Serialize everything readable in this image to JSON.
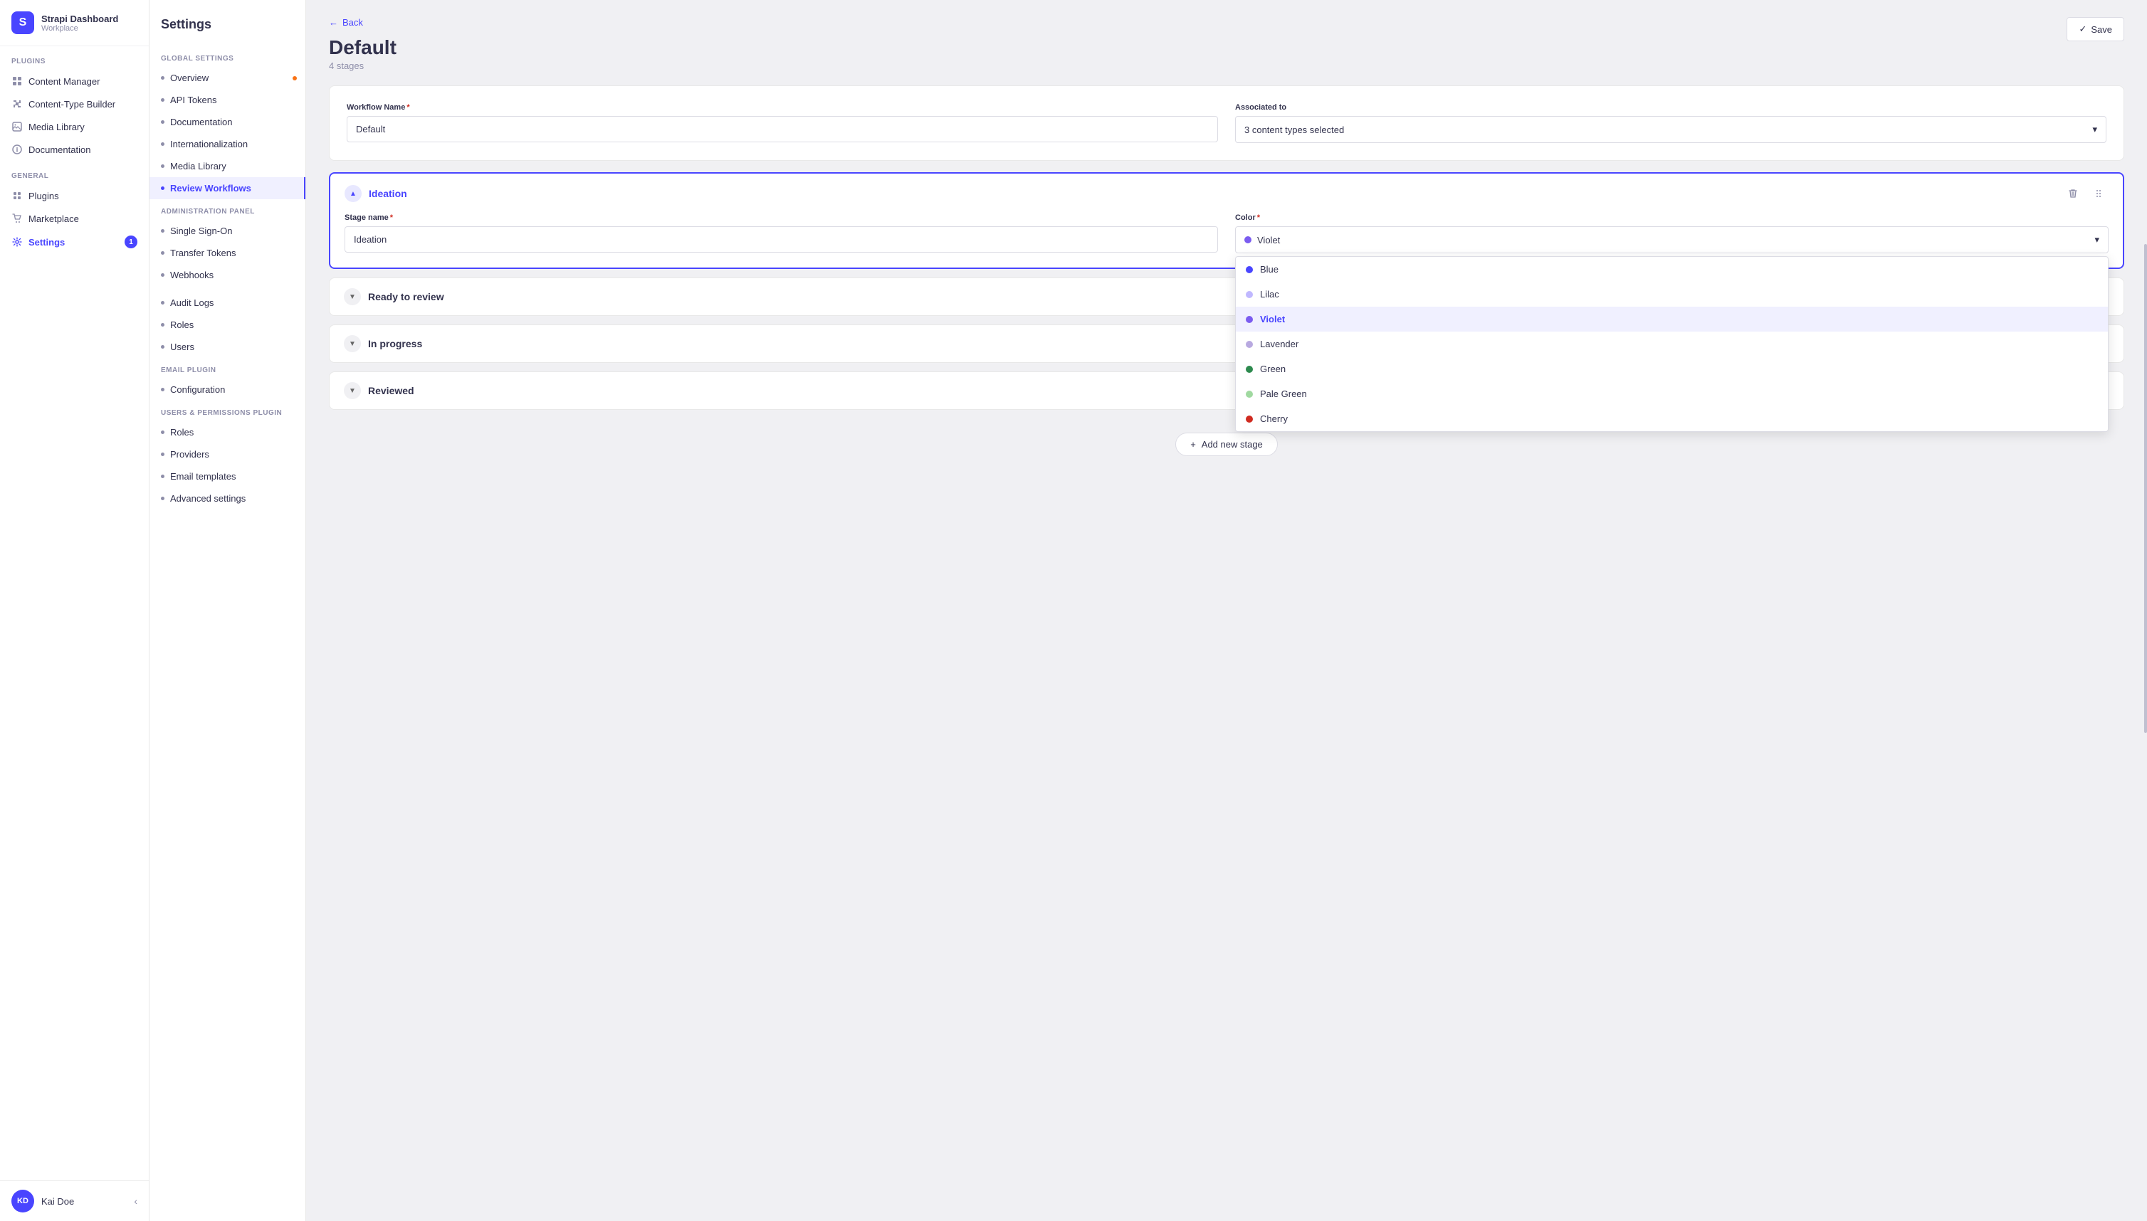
{
  "app": {
    "name": "Strapi Dashboard",
    "workspace": "Workplace",
    "logo_text": "S"
  },
  "sidebar": {
    "sections": [
      {
        "label": "PLUGINS",
        "items": [
          {
            "id": "content-manager",
            "label": "Content Manager",
            "icon": "grid-icon"
          },
          {
            "id": "content-type-builder",
            "label": "Content-Type Builder",
            "icon": "puzzle-icon"
          },
          {
            "id": "media-library",
            "label": "Media Library",
            "icon": "image-icon"
          },
          {
            "id": "documentation",
            "label": "Documentation",
            "icon": "info-icon"
          }
        ]
      },
      {
        "label": "GENERAL",
        "items": [
          {
            "id": "plugins",
            "label": "Plugins",
            "icon": "plugin-icon"
          },
          {
            "id": "marketplace",
            "label": "Marketplace",
            "icon": "shopping-cart-icon"
          },
          {
            "id": "settings",
            "label": "Settings",
            "icon": "gear-icon",
            "active": true,
            "badge": "1"
          }
        ]
      }
    ],
    "user": {
      "name": "Kai Doe",
      "initials": "KD"
    }
  },
  "settings_nav": {
    "title": "Settings",
    "sections": [
      {
        "label": "GLOBAL SETTINGS",
        "items": [
          {
            "id": "overview",
            "label": "Overview",
            "has_dot": true
          },
          {
            "id": "api-tokens",
            "label": "API Tokens"
          },
          {
            "id": "documentation",
            "label": "Documentation"
          },
          {
            "id": "internationalization",
            "label": "Internationalization"
          },
          {
            "id": "media-library",
            "label": "Media Library"
          },
          {
            "id": "review-workflows",
            "label": "Review Workflows",
            "active": true
          }
        ]
      },
      {
        "label": "ADMINISTRATION PANEL",
        "items": [
          {
            "id": "single-sign-on",
            "label": "Single Sign-On"
          },
          {
            "id": "transfer-tokens",
            "label": "Transfer Tokens"
          },
          {
            "id": "webhooks",
            "label": "Webhooks"
          }
        ]
      },
      {
        "label": "ADMINISTRATION PANEL",
        "show_label": false,
        "items": [
          {
            "id": "audit-logs",
            "label": "Audit Logs"
          },
          {
            "id": "roles",
            "label": "Roles"
          },
          {
            "id": "users",
            "label": "Users"
          }
        ]
      },
      {
        "label": "EMAIL PLUGIN",
        "items": [
          {
            "id": "configuration",
            "label": "Configuration"
          }
        ]
      },
      {
        "label": "USERS & PERMISSIONS PLUGIN",
        "items": [
          {
            "id": "roles-perm",
            "label": "Roles"
          },
          {
            "id": "providers",
            "label": "Providers"
          },
          {
            "id": "email-templates",
            "label": "Email templates"
          },
          {
            "id": "advanced-settings",
            "label": "Advanced settings"
          }
        ]
      }
    ]
  },
  "page": {
    "back_label": "Back",
    "title": "Default",
    "subtitle": "4 stages",
    "save_label": "Save",
    "save_icon": "✓"
  },
  "workflow_form": {
    "name_label": "Workflow Name",
    "name_required": true,
    "name_value": "Default",
    "associated_label": "Associated to",
    "associated_value": "3 content types selected"
  },
  "stages": [
    {
      "id": "ideation",
      "name": "Ideation",
      "expanded": true,
      "color_value": "Violet",
      "color_hex": "#7b5cf0",
      "stage_name_label": "Stage name",
      "color_label": "Color"
    },
    {
      "id": "ready-to-review",
      "name": "Ready to review",
      "expanded": false
    },
    {
      "id": "in-progress",
      "name": "In progress",
      "expanded": false
    },
    {
      "id": "reviewed",
      "name": "Reviewed",
      "expanded": false
    }
  ],
  "color_options": [
    {
      "id": "blue",
      "label": "Blue",
      "hex": "#4945ff"
    },
    {
      "id": "lilac",
      "label": "Lilac",
      "hex": "#c0b8ff"
    },
    {
      "id": "violet",
      "label": "Violet",
      "hex": "#7b5cf0",
      "selected": true
    },
    {
      "id": "lavender",
      "label": "Lavender",
      "hex": "#b8a9e0"
    },
    {
      "id": "green",
      "label": "Green",
      "hex": "#2d8a4e"
    },
    {
      "id": "pale-green",
      "label": "Pale Green",
      "hex": "#a0d9a0"
    },
    {
      "id": "cherry",
      "label": "Cherry",
      "hex": "#d02b20"
    }
  ],
  "add_stage_label": "+ Add new stage"
}
